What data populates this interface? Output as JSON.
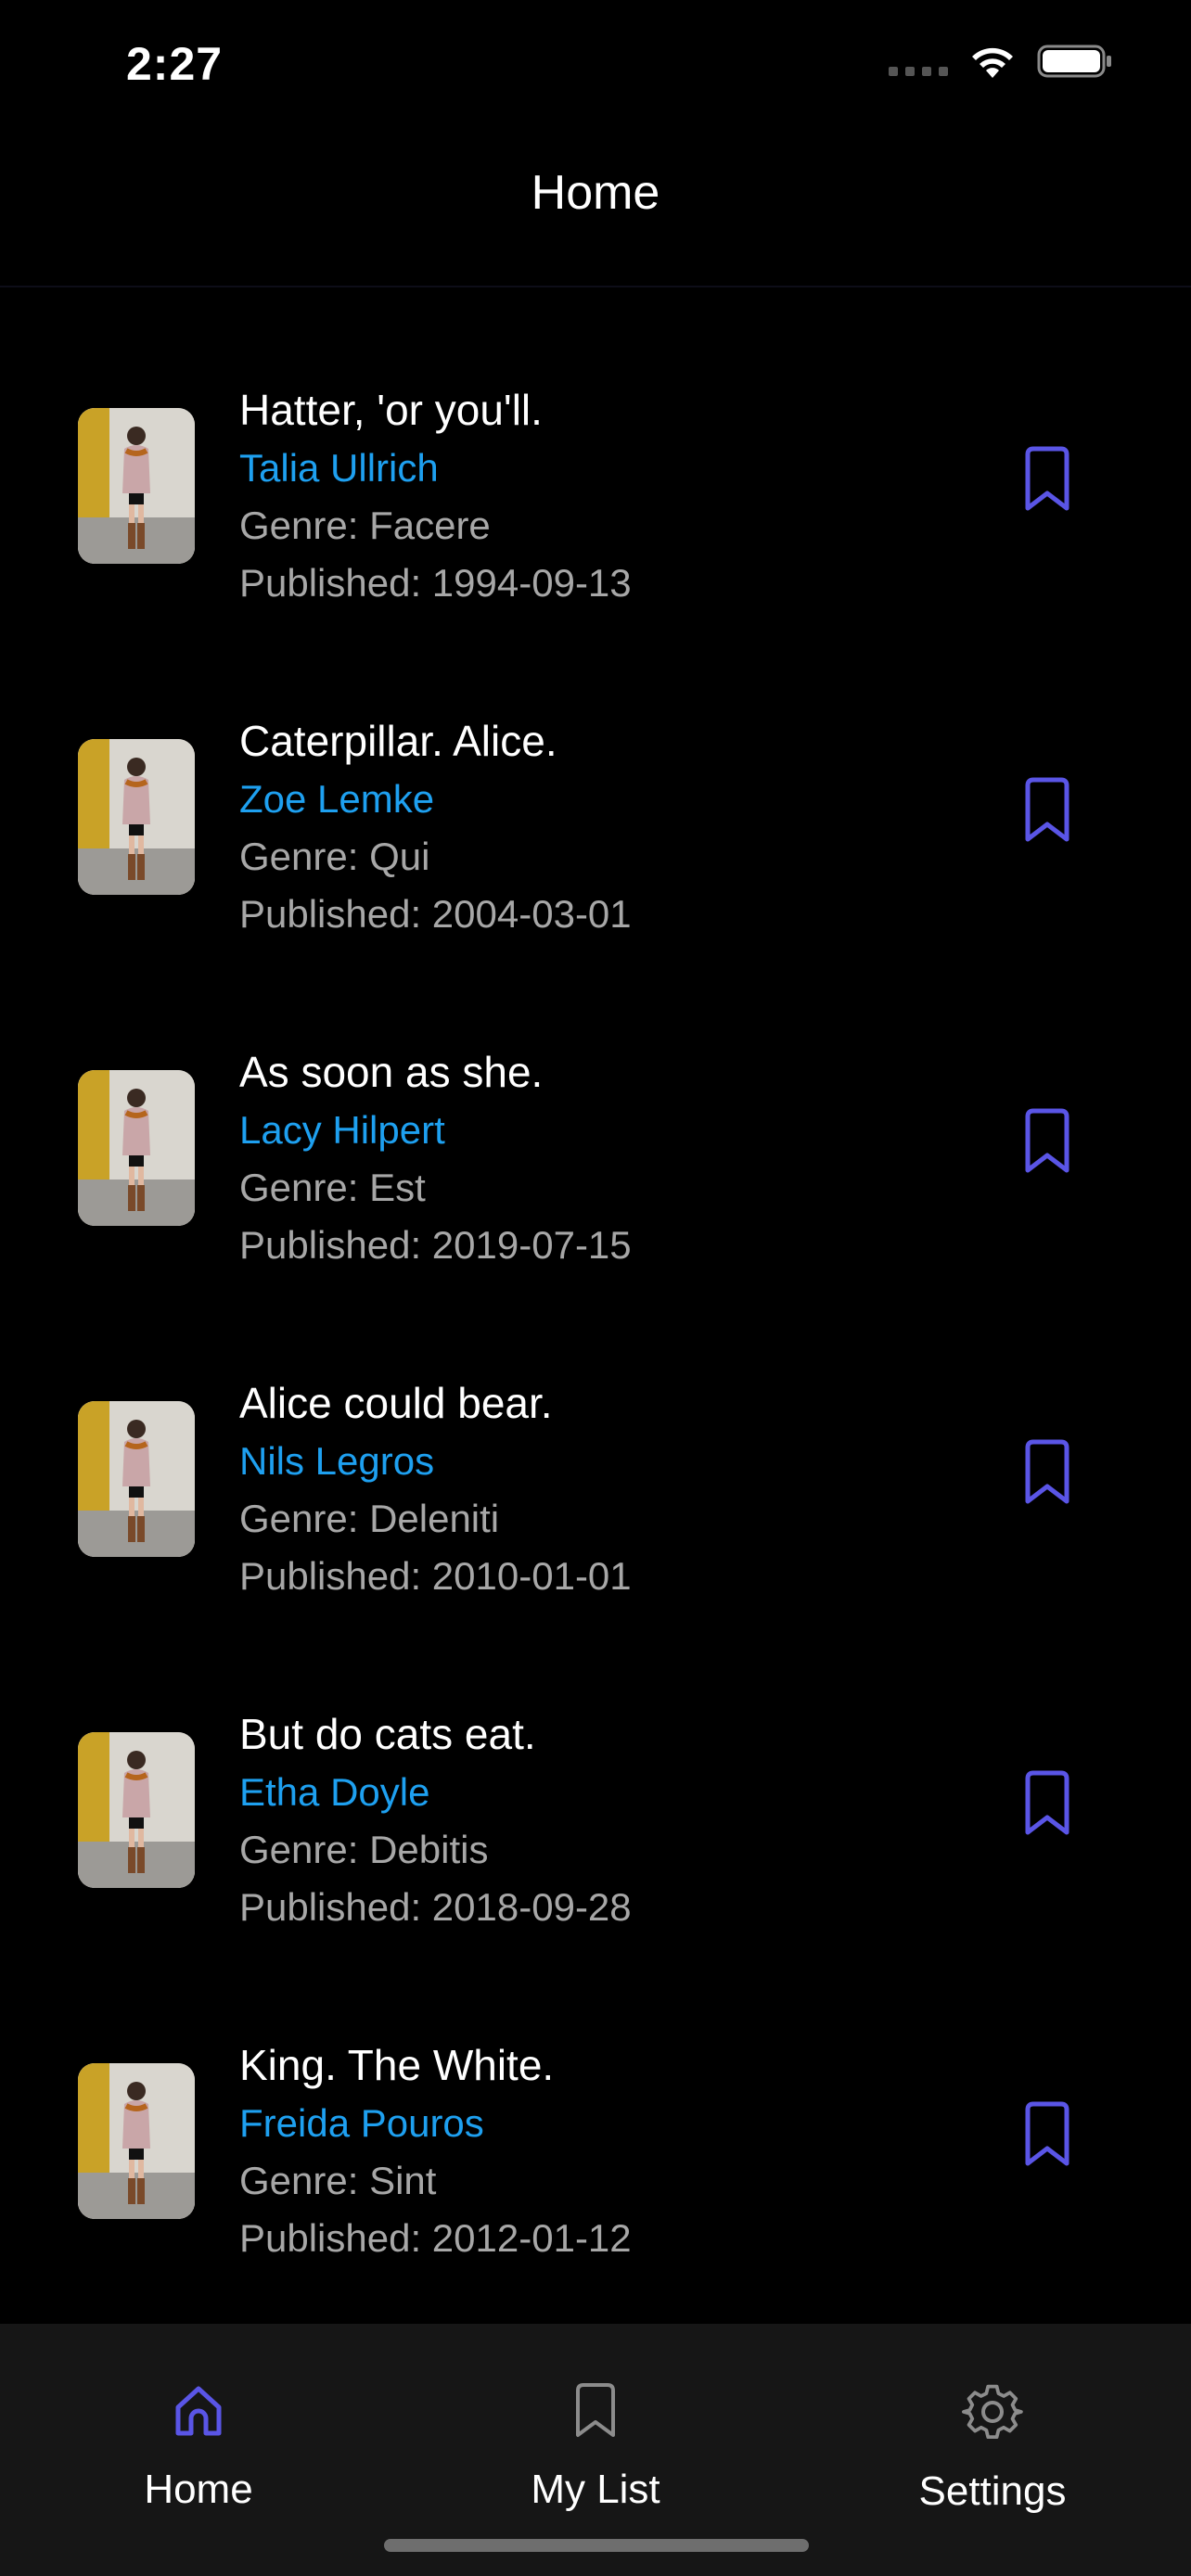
{
  "status_bar": {
    "time": "2:27"
  },
  "header": {
    "title": "Home"
  },
  "colors": {
    "accent": "#5a55e6",
    "author": "#1ea0f0",
    "meta": "#a7a7a7",
    "tab_bar_bg": "#161616"
  },
  "books": [
    {
      "title": "Hatter, 'or you'll.",
      "author": "Talia Ullrich",
      "genre": "Genre: Facere",
      "published": "Published: 1994-09-13"
    },
    {
      "title": "Caterpillar. Alice.",
      "author": "Zoe Lemke",
      "genre": "Genre: Qui",
      "published": "Published: 2004-03-01"
    },
    {
      "title": "As soon as she.",
      "author": "Lacy Hilpert",
      "genre": "Genre: Est",
      "published": "Published: 2019-07-15"
    },
    {
      "title": "Alice could bear.",
      "author": "Nils Legros",
      "genre": "Genre: Deleniti",
      "published": "Published: 2010-01-01"
    },
    {
      "title": "But do cats eat.",
      "author": "Etha Doyle",
      "genre": "Genre: Debitis",
      "published": "Published: 2018-09-28"
    },
    {
      "title": "King. The White.",
      "author": "Freida Pouros",
      "genre": "Genre: Sint",
      "published": "Published: 2012-01-12"
    }
  ],
  "tabs": [
    {
      "label": "Home",
      "icon": "home-icon",
      "active": true
    },
    {
      "label": "My List",
      "icon": "bookmark-icon",
      "active": false
    },
    {
      "label": "Settings",
      "icon": "gear-icon",
      "active": false
    }
  ]
}
